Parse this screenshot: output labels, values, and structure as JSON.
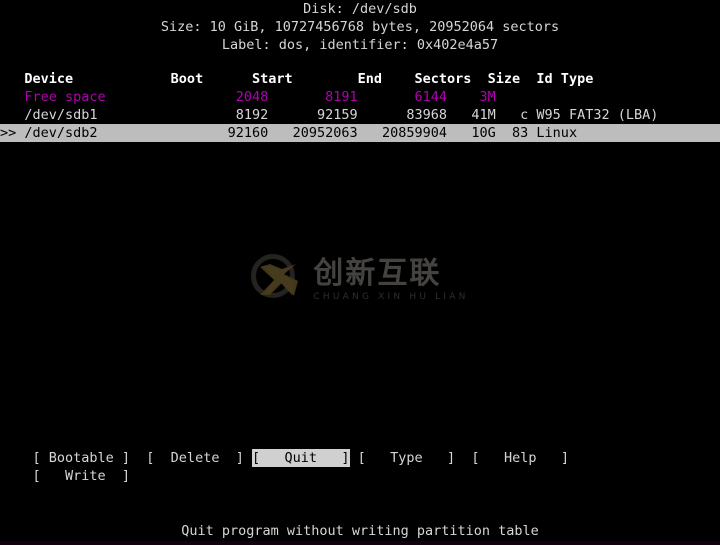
{
  "app": {
    "name": "cfdisk",
    "screen_bg": "#000000",
    "fg": "#d6d6d6",
    "accent_free_space": "#b000b0",
    "selection_bg": "#bdbdbd",
    "selection_fg": "#000000",
    "button_active_bg": "#d0d0d0"
  },
  "header": {
    "disk_line": "Disk: /dev/sdb",
    "size_line": "Size: 10 GiB, 10727456768 bytes, 20952064 sectors",
    "label_line": "Label: dos, identifier: 0x402e4a57"
  },
  "table": {
    "columns": [
      "Device",
      "Boot",
      "Start",
      "End",
      "Sectors",
      "Size",
      "Id",
      "Type"
    ],
    "header_line": "   Device            Boot      Start        End    Sectors  Size  Id Type",
    "rows": [
      {
        "marker": "",
        "device": "Free space",
        "boot": "",
        "start": "2048",
        "end": "8191",
        "sectors": "6144",
        "size": "3M",
        "id": "",
        "type": "",
        "selected": false,
        "free_space": true,
        "line": "   Free space                2048       8191       6144    3M"
      },
      {
        "marker": "",
        "device": "/dev/sdb1",
        "boot": "",
        "start": "8192",
        "end": "92159",
        "sectors": "83968",
        "size": "41M",
        "id": "c",
        "type": "W95 FAT32 (LBA)",
        "selected": false,
        "free_space": false,
        "line": "   /dev/sdb1                 8192      92159      83968   41M   c W95 FAT32 (LBA)"
      },
      {
        "marker": ">>",
        "device": "/dev/sdb2",
        "boot": "",
        "start": "92160",
        "end": "20952063",
        "sectors": "20859904",
        "size": "10G",
        "id": "83",
        "type": "Linux",
        "selected": true,
        "free_space": false,
        "line": ">> /dev/sdb2                92160   20952063   20859904   10G  83 Linux                   "
      }
    ]
  },
  "menu": {
    "row1_line": "    [ Bootable ]  [  Delete  ] ",
    "row1_after": " [   Type   ]  [   Help   ]",
    "active_button": "[   Quit   ]",
    "row2_line": "    [   Write  ]",
    "buttons": [
      {
        "label": "Bootable",
        "active": false
      },
      {
        "label": "Delete",
        "active": false
      },
      {
        "label": "Quit",
        "active": true
      },
      {
        "label": "Type",
        "active": false
      },
      {
        "label": "Help",
        "active": false
      },
      {
        "label": "Write",
        "active": false
      }
    ]
  },
  "status": {
    "text": "Quit program without writing partition table"
  },
  "watermark": {
    "chinese": "创新互联",
    "pinyin": "CHUANG XIN HU LIAN",
    "icon": "cx-circle-logo"
  }
}
